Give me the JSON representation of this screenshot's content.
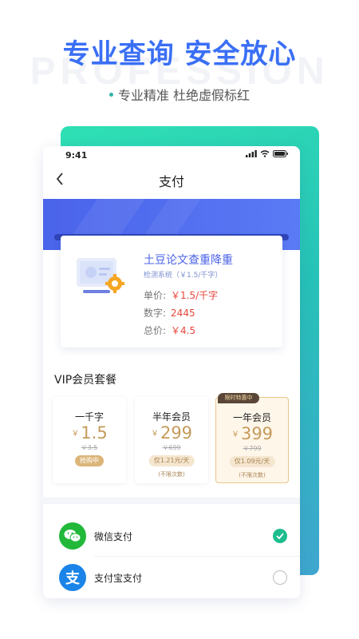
{
  "promo": {
    "watermark": "PROFESSION",
    "headline": "专业查询 安全放心",
    "subline": "专业精准 杜绝虚假标红"
  },
  "status_bar": {
    "time": "9:41"
  },
  "nav": {
    "title": "支付"
  },
  "product": {
    "name": "土豆论文查重降重",
    "rate": "检测系统（￥1.5/千字）",
    "unit_price_label": "单价:",
    "unit_price": "￥1.5/千字",
    "word_count_label": "数字:",
    "word_count": "2445",
    "total_label": "总价:",
    "total": "￥4.5"
  },
  "vip": {
    "title": "VIP会员套餐",
    "plans": [
      {
        "name": "一千字",
        "currency": "￥",
        "price": "1.5",
        "original": "￥3.5",
        "pill": "抢购中",
        "note": ""
      },
      {
        "name": "半年会员",
        "currency": "￥",
        "price": "299",
        "original": "￥699",
        "pill": "仅1.21元/天",
        "note": "(不限次数)"
      },
      {
        "name": "一年会员",
        "currency": "￥",
        "price": "399",
        "original": "￥799",
        "pill": "仅1.09元/天",
        "note": "(不限次数)",
        "badge": "限时特惠中"
      }
    ]
  },
  "payment": {
    "wechat_label": "微信支付",
    "alipay_label": "支付宝支付",
    "alipay_glyph": "支",
    "selected": "wechat"
  },
  "colors": {
    "brand_blue": "#3a6ff5",
    "teal": "#2fe0b4",
    "gold": "#c59b5b",
    "price_red": "#e8463c",
    "wechat_green": "#22b83a",
    "alipay_blue": "#1a84e8"
  }
}
